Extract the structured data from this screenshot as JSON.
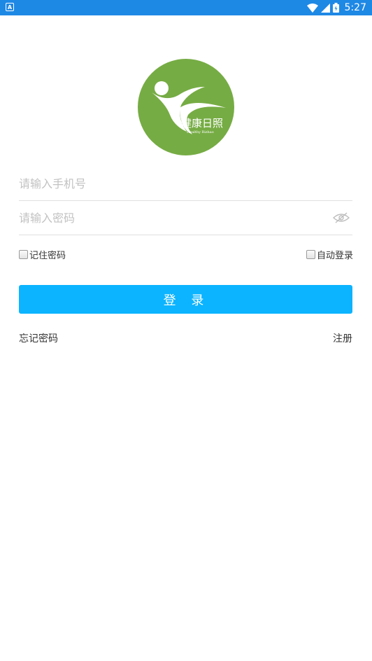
{
  "status_bar": {
    "time": "5:27",
    "notification_badge": "A"
  },
  "logo": {
    "brand_cn": "健康日照",
    "brand_en": "Healthy Rizhao",
    "color": "#76ac44"
  },
  "form": {
    "phone_placeholder": "请输入手机号",
    "password_placeholder": "请输入密码",
    "remember_password_label": "记住密码",
    "auto_login_label": "自动登录",
    "login_label": "登 录",
    "forgot_password_label": "忘记密码",
    "register_label": "注册"
  },
  "colors": {
    "status_bar": "#1e88e5",
    "primary_button": "#0cb4ff"
  }
}
